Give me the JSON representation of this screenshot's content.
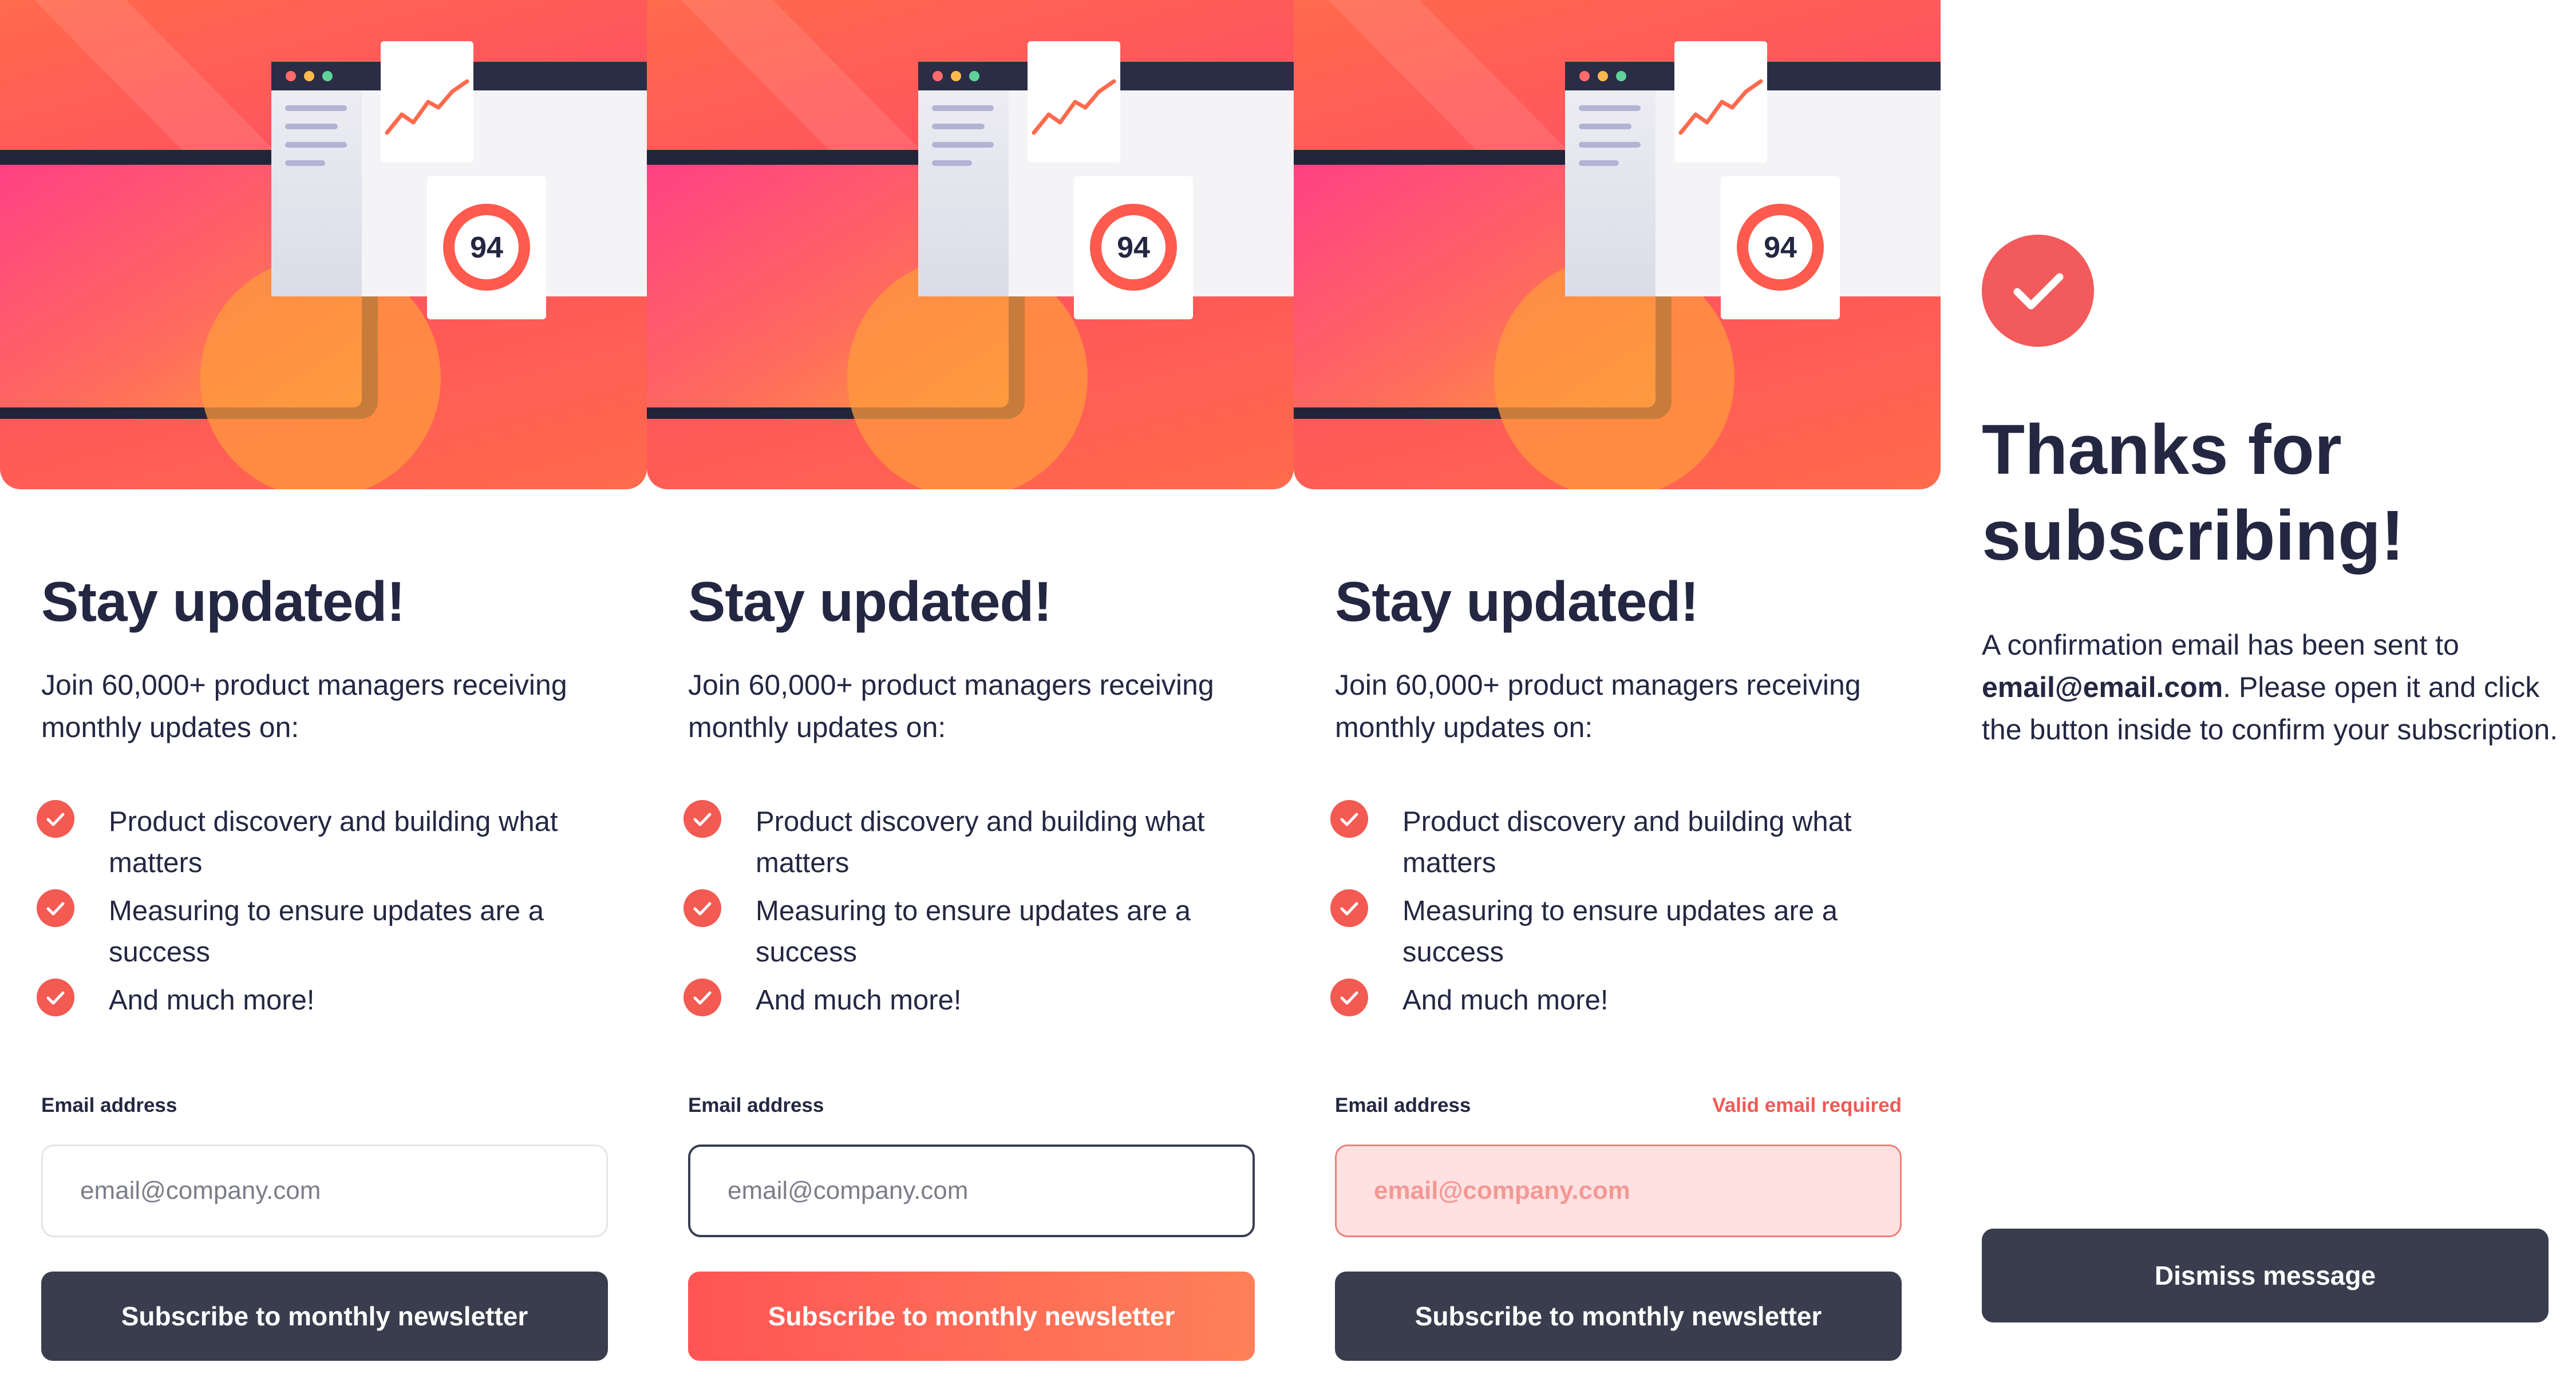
{
  "colors": {
    "accent": "#f25a52",
    "dark_button": "#393d4d",
    "heading": "#242742",
    "error": "#f05a55",
    "error_bg": "#ffe1e1"
  },
  "hero": {
    "score": "94"
  },
  "signup": {
    "heading": "Stay updated!",
    "intro": "Join 60,000+ product managers receiving monthly updates on:",
    "benefits": [
      "Product discovery and building what matters",
      "Measuring to ensure updates are a success",
      "And much more!"
    ],
    "email_label": "Email address",
    "email_placeholder": "email@company.com",
    "subscribe_label": "Subscribe to monthly newsletter",
    "error_message": "Valid email required"
  },
  "states": [
    "default",
    "focused",
    "error"
  ],
  "success": {
    "icon": "check-icon",
    "heading": "Thanks for subscribing!",
    "message_prefix": "A confirmation email has been sent to ",
    "email": "email@email.com",
    "message_suffix": ". Please open it and click the button inside to confirm your subscription.",
    "dismiss_label": "Dismiss message"
  }
}
